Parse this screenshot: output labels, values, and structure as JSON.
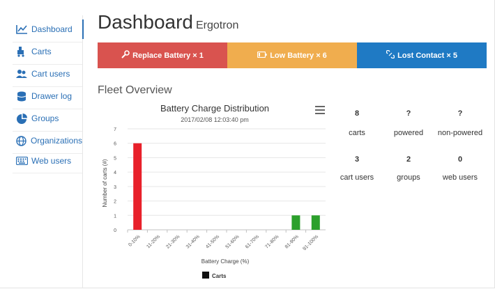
{
  "nav": {
    "items": [
      {
        "label": "Dashboard",
        "icon": "line-chart-icon"
      },
      {
        "label": "Carts",
        "icon": "cart-icon"
      },
      {
        "label": "Cart users",
        "icon": "users-icon"
      },
      {
        "label": "Drawer log",
        "icon": "database-icon"
      },
      {
        "label": "Groups",
        "icon": "pie-chart-icon"
      },
      {
        "label": "Organizations",
        "icon": "globe-icon"
      },
      {
        "label": "Web users",
        "icon": "keyboard-icon"
      }
    ],
    "active_color": "#2a6fb5"
  },
  "header": {
    "title": "Dashboard",
    "subtitle": "Ergotron"
  },
  "alerts": [
    {
      "label": "Replace Battery × 1",
      "color": "#d9534f",
      "icon": "wrench-icon"
    },
    {
      "label": "Low Battery × 6",
      "color": "#f0ad4e",
      "icon": "battery-low-icon"
    },
    {
      "label": "Lost Contact × 5",
      "color": "#1f7ac4",
      "icon": "unlink-icon"
    }
  ],
  "section": {
    "title": "Fleet Overview"
  },
  "stats": [
    {
      "value": "8",
      "label": "carts"
    },
    {
      "value": "?",
      "label": "powered"
    },
    {
      "value": "?",
      "label": "non-powered"
    },
    {
      "value": "3",
      "label": "cart users"
    },
    {
      "value": "2",
      "label": "groups"
    },
    {
      "value": "0",
      "label": "web users"
    }
  ],
  "chart_data": {
    "type": "bar",
    "title": "Battery Charge Distribution",
    "subtitle": "2017/02/08 12:03:40 pm",
    "xlabel": "Battery Charge (%)",
    "ylabel": "Number of carts (#)",
    "categories": [
      "0-10%",
      "11-20%",
      "21-30%",
      "31-40%",
      "41-50%",
      "51-60%",
      "61-70%",
      "71-80%",
      "81-90%",
      "91-100%"
    ],
    "values": [
      6,
      0,
      0,
      0,
      0,
      0,
      0,
      0,
      1,
      1
    ],
    "bar_colors": [
      "#e8202a",
      "#e8202a",
      "#e8202a",
      "#f0ad4e",
      "#f0ad4e",
      "#f0ad4e",
      "#f0ad4e",
      "#2ca02c",
      "#2ca02c",
      "#2ca02c"
    ],
    "yticks": [
      0,
      1,
      2,
      3,
      4,
      5,
      6,
      7
    ],
    "ylim": [
      0,
      7
    ],
    "grid": true,
    "legend": {
      "label": "Carts",
      "color": "#111111",
      "position": "bottom"
    }
  }
}
